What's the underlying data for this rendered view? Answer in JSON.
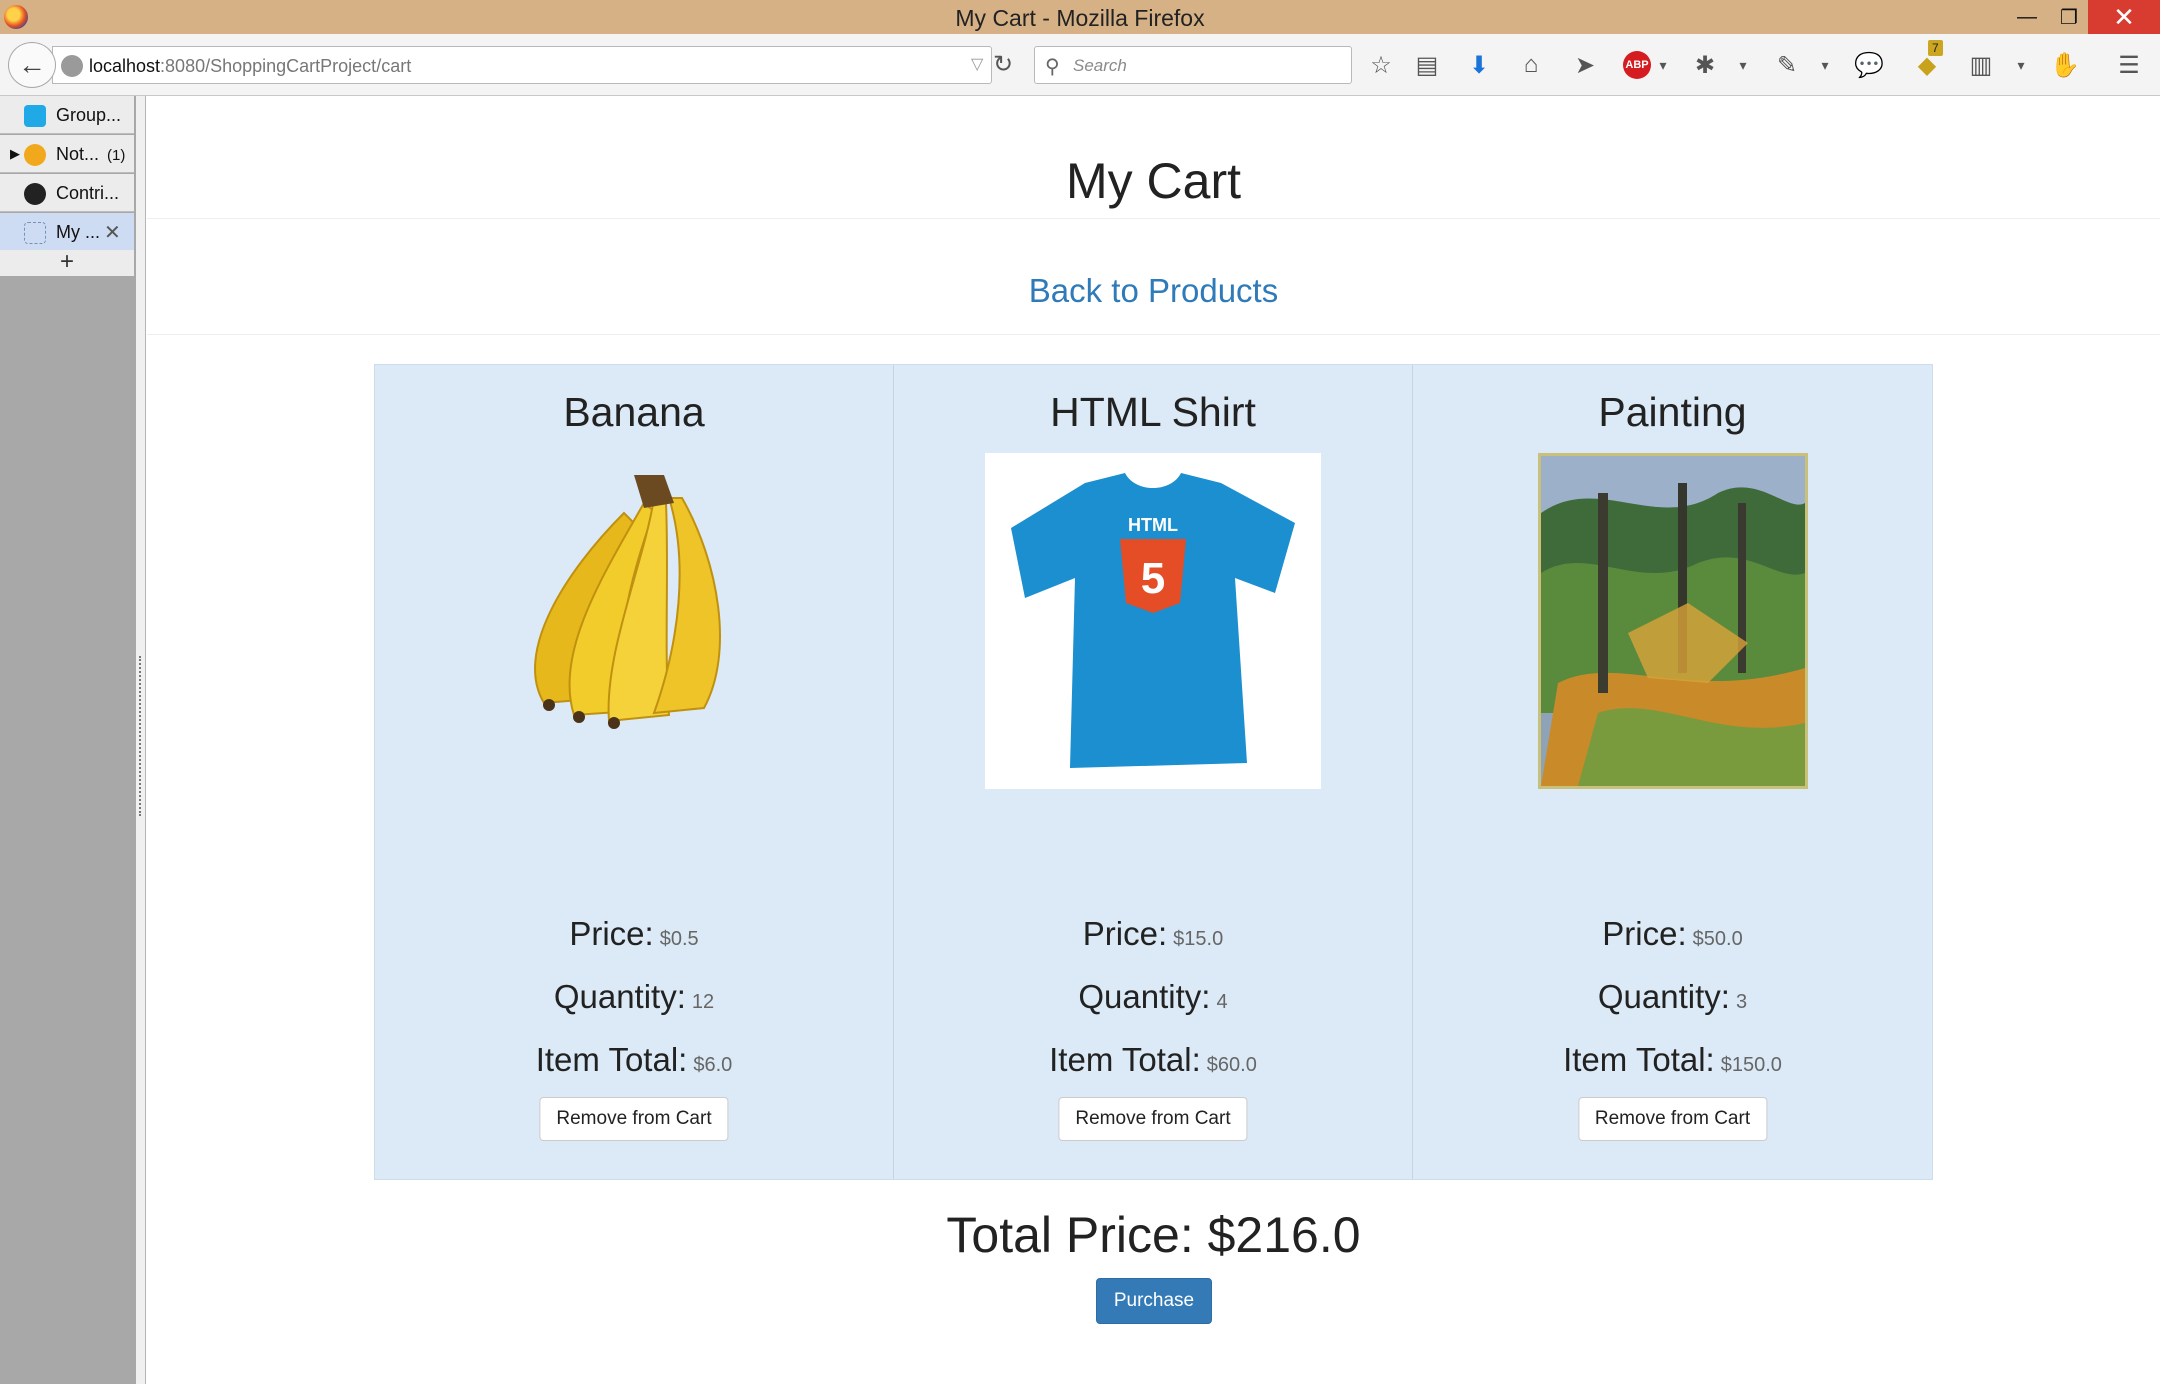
{
  "window": {
    "title": "My Cart - Mozilla Firefox"
  },
  "toolbar": {
    "url_host": "localhost",
    "url_rest": ":8080/ShoppingCartProject/cart",
    "search_placeholder": "Search",
    "notification_count": "7"
  },
  "sidebar": {
    "tabs": [
      {
        "label": "Group...",
        "count": "",
        "icon": "groupme-icon",
        "color": "#1fa9e6"
      },
      {
        "label": "Not...",
        "count": "(1)",
        "icon": "walmart-spark-icon",
        "color": "#f2a81d"
      },
      {
        "label": "Contri...",
        "count": "",
        "icon": "github-icon",
        "color": "#222222"
      },
      {
        "label": "My ...",
        "count": "",
        "icon": "blank-page-icon",
        "color": "#7a8fb8"
      }
    ],
    "new_tab": "+"
  },
  "page": {
    "title": "My Cart",
    "back_link": "Back to Products",
    "price_label": "Price:",
    "quantity_label": "Quantity:",
    "item_total_label": "Item Total:",
    "remove_label": "Remove from Cart",
    "total_label": "Total Price: $216.0",
    "purchase_label": "Purchase"
  },
  "items": [
    {
      "name": "Banana",
      "price": "$0.5",
      "quantity": "12",
      "total": "$6.0",
      "image": "banana-image"
    },
    {
      "name": "HTML Shirt",
      "price": "$15.0",
      "quantity": "4",
      "total": "$60.0",
      "image": "html5-shirt-image"
    },
    {
      "name": "Painting",
      "price": "$50.0",
      "quantity": "3",
      "total": "$150.0",
      "image": "painting-image"
    }
  ],
  "colors": {
    "link": "#2f7ab8",
    "card_bg": "#dbeaf6",
    "primary_button": "#337ab7"
  }
}
